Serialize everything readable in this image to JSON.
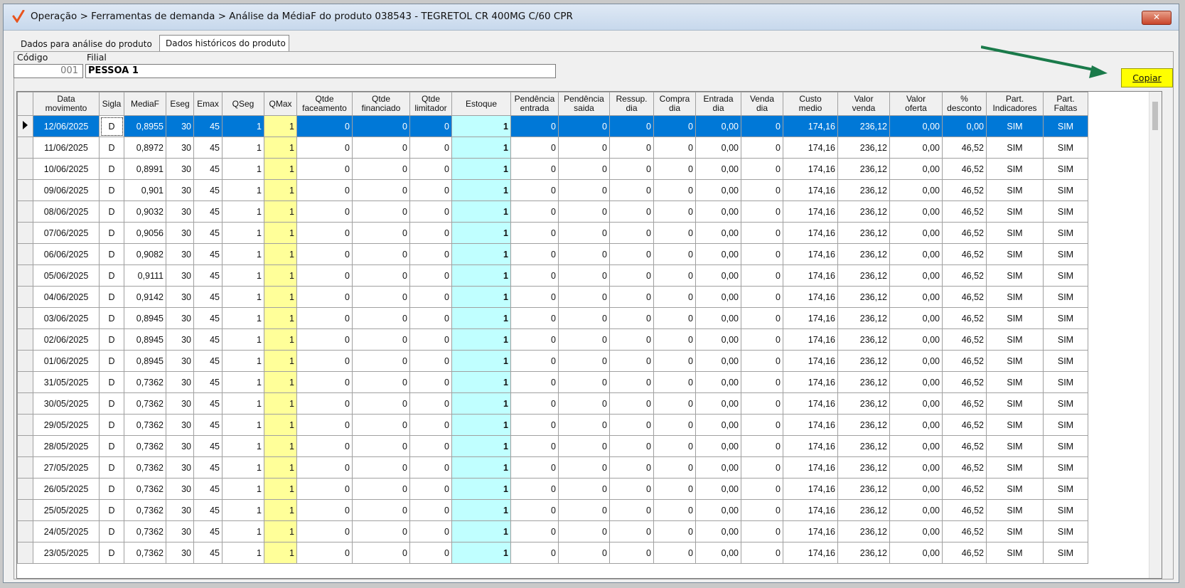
{
  "window": {
    "title": "Operação > Ferramentas de demanda > Análise da MédiaF do produto 038543 - TEGRETOL CR 400MG C/60 CPR",
    "close_label": "✕"
  },
  "tabs": [
    "Dados para análise do produto",
    "Dados históricos do produto"
  ],
  "filters": {
    "codigo_label": "Código",
    "codigo_value": "001",
    "filial_label": "Filial",
    "filial_value": "PESSOA 1"
  },
  "copy_button": {
    "label": "Copiar"
  },
  "colors": {
    "selected_row": "#0078d7",
    "qmax_bg": "#ffff99",
    "estoque_bg": "#c0ffff",
    "copy_bg": "#ffff00",
    "arrow": "#1a7a4a"
  },
  "columns": [
    "Data movimento",
    "Sigla",
    "MediaF",
    "Eseg",
    "Emax",
    "QSeg",
    "QMax",
    "Qtde faceamento",
    "Qtde financiado",
    "Qtde limitador",
    "Estoque",
    "Pendência entrada",
    "Pendência saida",
    "Ressup. dia",
    "Compra dia",
    "Entrada dia",
    "Venda dia",
    "Custo medio",
    "Valor venda",
    "Valor oferta",
    "% desconto",
    "Part. Indicadores",
    "Part. Faltas"
  ],
  "rows": [
    [
      "12/06/2025",
      "D",
      "0,8955",
      "30",
      "45",
      "1",
      "1",
      "0",
      "0",
      "0",
      "1",
      "0",
      "0",
      "0",
      "0",
      "0,00",
      "0",
      "174,16",
      "236,12",
      "0,00",
      "0,00",
      "SIM",
      "SIM"
    ],
    [
      "11/06/2025",
      "D",
      "0,8972",
      "30",
      "45",
      "1",
      "1",
      "0",
      "0",
      "0",
      "1",
      "0",
      "0",
      "0",
      "0",
      "0,00",
      "0",
      "174,16",
      "236,12",
      "0,00",
      "46,52",
      "SIM",
      "SIM"
    ],
    [
      "10/06/2025",
      "D",
      "0,8991",
      "30",
      "45",
      "1",
      "1",
      "0",
      "0",
      "0",
      "1",
      "0",
      "0",
      "0",
      "0",
      "0,00",
      "0",
      "174,16",
      "236,12",
      "0,00",
      "46,52",
      "SIM",
      "SIM"
    ],
    [
      "09/06/2025",
      "D",
      "0,901",
      "30",
      "45",
      "1",
      "1",
      "0",
      "0",
      "0",
      "1",
      "0",
      "0",
      "0",
      "0",
      "0,00",
      "0",
      "174,16",
      "236,12",
      "0,00",
      "46,52",
      "SIM",
      "SIM"
    ],
    [
      "08/06/2025",
      "D",
      "0,9032",
      "30",
      "45",
      "1",
      "1",
      "0",
      "0",
      "0",
      "1",
      "0",
      "0",
      "0",
      "0",
      "0,00",
      "0",
      "174,16",
      "236,12",
      "0,00",
      "46,52",
      "SIM",
      "SIM"
    ],
    [
      "07/06/2025",
      "D",
      "0,9056",
      "30",
      "45",
      "1",
      "1",
      "0",
      "0",
      "0",
      "1",
      "0",
      "0",
      "0",
      "0",
      "0,00",
      "0",
      "174,16",
      "236,12",
      "0,00",
      "46,52",
      "SIM",
      "SIM"
    ],
    [
      "06/06/2025",
      "D",
      "0,9082",
      "30",
      "45",
      "1",
      "1",
      "0",
      "0",
      "0",
      "1",
      "0",
      "0",
      "0",
      "0",
      "0,00",
      "0",
      "174,16",
      "236,12",
      "0,00",
      "46,52",
      "SIM",
      "SIM"
    ],
    [
      "05/06/2025",
      "D",
      "0,9111",
      "30",
      "45",
      "1",
      "1",
      "0",
      "0",
      "0",
      "1",
      "0",
      "0",
      "0",
      "0",
      "0,00",
      "0",
      "174,16",
      "236,12",
      "0,00",
      "46,52",
      "SIM",
      "SIM"
    ],
    [
      "04/06/2025",
      "D",
      "0,9142",
      "30",
      "45",
      "1",
      "1",
      "0",
      "0",
      "0",
      "1",
      "0",
      "0",
      "0",
      "0",
      "0,00",
      "0",
      "174,16",
      "236,12",
      "0,00",
      "46,52",
      "SIM",
      "SIM"
    ],
    [
      "03/06/2025",
      "D",
      "0,8945",
      "30",
      "45",
      "1",
      "1",
      "0",
      "0",
      "0",
      "1",
      "0",
      "0",
      "0",
      "0",
      "0,00",
      "0",
      "174,16",
      "236,12",
      "0,00",
      "46,52",
      "SIM",
      "SIM"
    ],
    [
      "02/06/2025",
      "D",
      "0,8945",
      "30",
      "45",
      "1",
      "1",
      "0",
      "0",
      "0",
      "1",
      "0",
      "0",
      "0",
      "0",
      "0,00",
      "0",
      "174,16",
      "236,12",
      "0,00",
      "46,52",
      "SIM",
      "SIM"
    ],
    [
      "01/06/2025",
      "D",
      "0,8945",
      "30",
      "45",
      "1",
      "1",
      "0",
      "0",
      "0",
      "1",
      "0",
      "0",
      "0",
      "0",
      "0,00",
      "0",
      "174,16",
      "236,12",
      "0,00",
      "46,52",
      "SIM",
      "SIM"
    ],
    [
      "31/05/2025",
      "D",
      "0,7362",
      "30",
      "45",
      "1",
      "1",
      "0",
      "0",
      "0",
      "1",
      "0",
      "0",
      "0",
      "0",
      "0,00",
      "0",
      "174,16",
      "236,12",
      "0,00",
      "46,52",
      "SIM",
      "SIM"
    ],
    [
      "30/05/2025",
      "D",
      "0,7362",
      "30",
      "45",
      "1",
      "1",
      "0",
      "0",
      "0",
      "1",
      "0",
      "0",
      "0",
      "0",
      "0,00",
      "0",
      "174,16",
      "236,12",
      "0,00",
      "46,52",
      "SIM",
      "SIM"
    ],
    [
      "29/05/2025",
      "D",
      "0,7362",
      "30",
      "45",
      "1",
      "1",
      "0",
      "0",
      "0",
      "1",
      "0",
      "0",
      "0",
      "0",
      "0,00",
      "0",
      "174,16",
      "236,12",
      "0,00",
      "46,52",
      "SIM",
      "SIM"
    ],
    [
      "28/05/2025",
      "D",
      "0,7362",
      "30",
      "45",
      "1",
      "1",
      "0",
      "0",
      "0",
      "1",
      "0",
      "0",
      "0",
      "0",
      "0,00",
      "0",
      "174,16",
      "236,12",
      "0,00",
      "46,52",
      "SIM",
      "SIM"
    ],
    [
      "27/05/2025",
      "D",
      "0,7362",
      "30",
      "45",
      "1",
      "1",
      "0",
      "0",
      "0",
      "1",
      "0",
      "0",
      "0",
      "0",
      "0,00",
      "0",
      "174,16",
      "236,12",
      "0,00",
      "46,52",
      "SIM",
      "SIM"
    ],
    [
      "26/05/2025",
      "D",
      "0,7362",
      "30",
      "45",
      "1",
      "1",
      "0",
      "0",
      "0",
      "1",
      "0",
      "0",
      "0",
      "0",
      "0,00",
      "0",
      "174,16",
      "236,12",
      "0,00",
      "46,52",
      "SIM",
      "SIM"
    ],
    [
      "25/05/2025",
      "D",
      "0,7362",
      "30",
      "45",
      "1",
      "1",
      "0",
      "0",
      "0",
      "1",
      "0",
      "0",
      "0",
      "0",
      "0,00",
      "0",
      "174,16",
      "236,12",
      "0,00",
      "46,52",
      "SIM",
      "SIM"
    ],
    [
      "24/05/2025",
      "D",
      "0,7362",
      "30",
      "45",
      "1",
      "1",
      "0",
      "0",
      "0",
      "1",
      "0",
      "0",
      "0",
      "0",
      "0,00",
      "0",
      "174,16",
      "236,12",
      "0,00",
      "46,52",
      "SIM",
      "SIM"
    ],
    [
      "23/05/2025",
      "D",
      "0,7362",
      "30",
      "45",
      "1",
      "1",
      "0",
      "0",
      "0",
      "1",
      "0",
      "0",
      "0",
      "0",
      "0,00",
      "0",
      "174,16",
      "236,12",
      "0,00",
      "46,52",
      "SIM",
      "SIM"
    ]
  ]
}
